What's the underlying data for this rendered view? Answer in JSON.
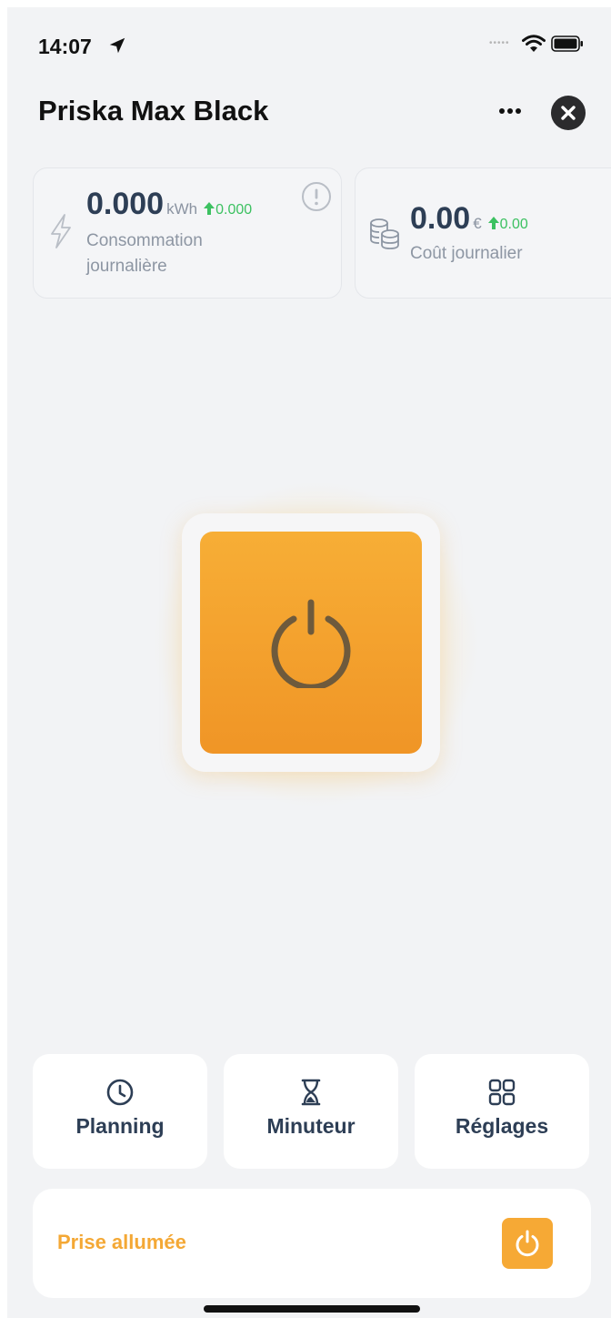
{
  "status_bar": {
    "time": "14:07",
    "icons": [
      "location-arrow-icon",
      "cellular-signal-icon",
      "wifi-icon",
      "battery-icon"
    ]
  },
  "header": {
    "title": "Priska Max Black",
    "more_icon": "more-horizontal-icon",
    "close_icon": "close-circle-icon"
  },
  "stats": {
    "energy": {
      "value": "0.000",
      "unit": "kWh",
      "trend": "0.000",
      "label": "Consommation journalière",
      "icon": "lightning-bolt-icon"
    },
    "cost": {
      "value": "0.00",
      "unit": "€",
      "trend": "0.00",
      "label": "Coût journalier",
      "icon": "coins-icon"
    }
  },
  "power": {
    "state_on": true,
    "icon": "power-icon"
  },
  "tiles": [
    {
      "label": "Planning",
      "icon": "clock-icon"
    },
    {
      "label": "Minuteur",
      "icon": "hourglass-icon"
    },
    {
      "label": "Réglages",
      "icon": "grid-icon"
    }
  ],
  "status": {
    "text": "Prise allumée",
    "icon": "power-icon"
  },
  "colors": {
    "accent": "#f6a935",
    "trend_green": "#3cc161",
    "text_dark": "#2d3e55",
    "background": "#f2f3f5"
  }
}
